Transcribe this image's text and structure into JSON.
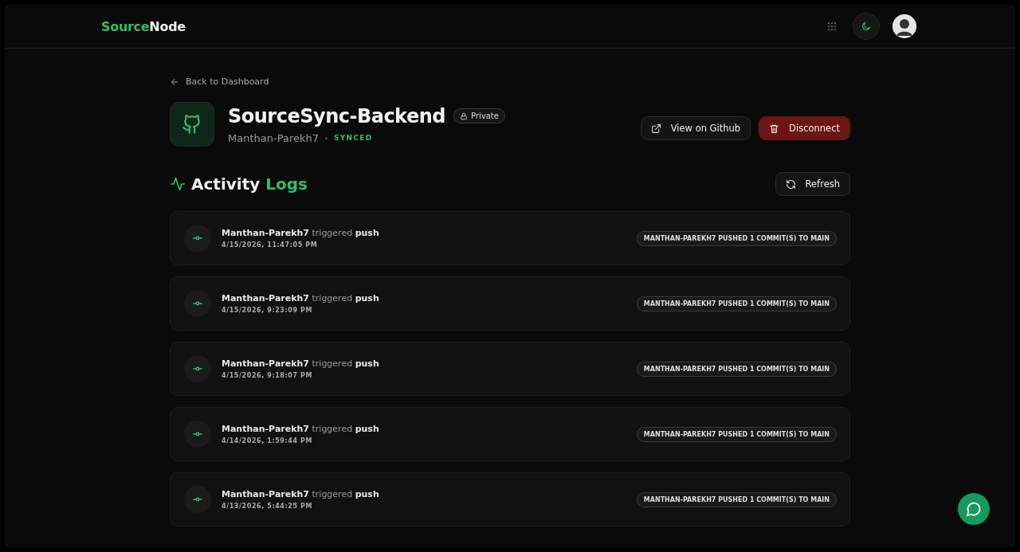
{
  "header": {
    "logo": {
      "first": "Source",
      "second": "Node"
    }
  },
  "back_link": "Back to Dashboard",
  "repo": {
    "name": "SourceSync-Backend",
    "visibility": "Private",
    "owner": "Manthan-Parekh7",
    "status": "SYNCED"
  },
  "actions": [
    {
      "label": "View on Github",
      "kind": "external"
    },
    {
      "label": "Disconnect",
      "kind": "danger"
    }
  ],
  "activity": {
    "title_first": "Activity",
    "title_second": "Logs",
    "refresh": "Refresh"
  },
  "logs": [
    {
      "actor": "Manthan-Parekh7",
      "verb": "triggered",
      "event": "push",
      "time": "4/15/2026, 11:47:05 PM",
      "message": "MANTHAN-PAREKH7 PUSHED 1 COMMIT(S) TO MAIN"
    },
    {
      "actor": "Manthan-Parekh7",
      "verb": "triggered",
      "event": "push",
      "time": "4/15/2026, 9:23:09 PM",
      "message": "MANTHAN-PAREKH7 PUSHED 1 COMMIT(S) TO MAIN"
    },
    {
      "actor": "Manthan-Parekh7",
      "verb": "triggered",
      "event": "push",
      "time": "4/15/2026, 9:18:07 PM",
      "message": "MANTHAN-PAREKH7 PUSHED 1 COMMIT(S) TO MAIN"
    },
    {
      "actor": "Manthan-Parekh7",
      "verb": "triggered",
      "event": "push",
      "time": "4/14/2026, 1:59:44 PM",
      "message": "MANTHAN-PAREKH7 PUSHED 1 COMMIT(S) TO MAIN"
    },
    {
      "actor": "Manthan-Parekh7",
      "verb": "triggered",
      "event": "push",
      "time": "4/13/2026, 5:44:25 PM",
      "message": "MANTHAN-PAREKH7 PUSHED 1 COMMIT(S) TO MAIN"
    }
  ]
}
